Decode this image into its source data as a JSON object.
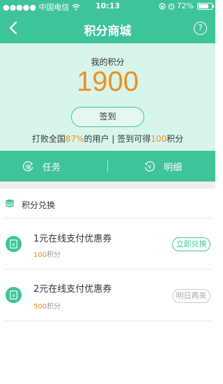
{
  "status_bar": {
    "carrier": "●●●●● 中国电信",
    "time": "10:13",
    "battery": "72%"
  },
  "nav": {
    "title": "积分商城",
    "help": "?"
  },
  "hero": {
    "label": "我的积分",
    "points": "1900",
    "checkin_label": "签到",
    "summary_prefix": "打败全国",
    "summary_percent": "87%",
    "summary_mid": "的用户 | 签到可得",
    "summary_bonus": "100",
    "summary_suffix": "积分"
  },
  "tabs": [
    {
      "label": "任务"
    },
    {
      "label": "明细"
    }
  ],
  "section": {
    "title": "积分兑换"
  },
  "coupons": [
    {
      "name": "1元在线支付优惠券",
      "cost": "100",
      "unit": "积分",
      "button": "立即兑换"
    },
    {
      "name": "2元在线支付优惠券",
      "cost": "500",
      "unit": "积分",
      "button": "明日再来"
    }
  ],
  "colors": {
    "brand": "#3ec39a",
    "accent": "#ef8f1f",
    "hero_bg": "#d8f5ec"
  }
}
